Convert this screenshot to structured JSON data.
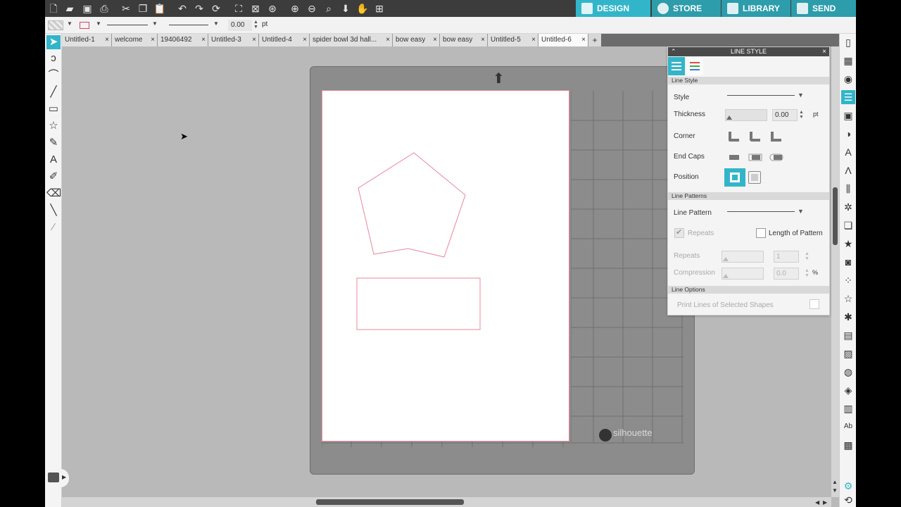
{
  "nav": {
    "design": "DESIGN",
    "store": "STORE",
    "library": "LIBRARY",
    "send": "SEND"
  },
  "toolbar_icons": [
    "new-file-icon",
    "open-icon",
    "save-icon",
    "print-icon",
    "cut-icon",
    "copy-icon",
    "paste-icon",
    "undo-icon",
    "redo-icon",
    "redraw-icon",
    "select-all-icon",
    "deselect-icon",
    "select-by-color-icon",
    "zoom-in-icon",
    "zoom-out-icon",
    "zoom-fit-icon",
    "move-icon",
    "pan-icon",
    "fit-to-page-icon"
  ],
  "options": {
    "line_width_value": "0.00",
    "line_width_unit": "pt"
  },
  "tabs": [
    {
      "label": "Untitled-1"
    },
    {
      "label": "welcome"
    },
    {
      "label": "19406492"
    },
    {
      "label": "Untitled-3"
    },
    {
      "label": "Untitled-4"
    },
    {
      "label": "spider bowl 3d hall..."
    },
    {
      "label": "bow easy"
    },
    {
      "label": "bow easy"
    },
    {
      "label": "Untitled-5"
    },
    {
      "label": "Untitled-6",
      "active": true
    }
  ],
  "tab_add": "+",
  "mat": {
    "brand": "silhouette"
  },
  "panel": {
    "title": "LINE STYLE",
    "sections": {
      "line_style": "Line Style",
      "line_patterns": "Line Patterns",
      "line_options": "Line Options"
    },
    "style_label": "Style",
    "thickness_label": "Thickness",
    "thickness_value": "0.00",
    "thickness_unit": "pt",
    "corner_label": "Corner",
    "end_caps_label": "End Caps",
    "position_label": "Position",
    "line_pattern_label": "Line Pattern",
    "repeats_checkbox_label": "Repeats",
    "length_of_pattern_label": "Length of Pattern",
    "repeats_label": "Repeats",
    "repeats_value": "1",
    "compression_label": "Compression",
    "compression_value": "0.0",
    "compression_unit": "%",
    "print_lines_label": "Print Lines of Selected Shapes"
  },
  "colors": {
    "accent": "#33b5c9",
    "nav_inactive": "#2d9cab",
    "topbar": "#3c3c3c",
    "canvas": "#b9b9b9",
    "mat": "#8c8c8c",
    "shape_stroke": "#e8879b"
  }
}
